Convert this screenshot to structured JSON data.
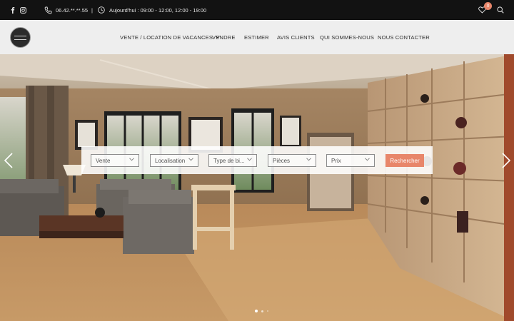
{
  "topbar": {
    "phone": "06.42.**.**.55",
    "separator": "|",
    "hours": "Aujourd'hui : 09:00 - 12:00, 12:00 - 19:00",
    "favorites_count": "0"
  },
  "nav": {
    "items": [
      {
        "label": "VENTE / LOCATION DE VACANCES"
      },
      {
        "label": "VENDRE"
      },
      {
        "label": "ESTIMER"
      },
      {
        "label": "AVIS CLIENTS"
      },
      {
        "label": "QUI SOMMES-NOUS"
      },
      {
        "label": "NOUS CONTACTER"
      }
    ]
  },
  "search": {
    "fields": [
      {
        "label": "Vente"
      },
      {
        "label": "Localisation"
      },
      {
        "label": "Type de bi..."
      },
      {
        "label": "Pièces"
      },
      {
        "label": "Prix"
      }
    ],
    "button_label": "Rechercher"
  },
  "icons": {
    "social": [
      "facebook-icon",
      "instagram-icon"
    ],
    "contact": [
      "phone-icon",
      "clock-icon"
    ],
    "actions": [
      "heart-icon",
      "search-icon"
    ],
    "slider": [
      "chevron-left-icon",
      "chevron-right-icon"
    ]
  },
  "slider": {
    "active_index": 0,
    "count": 3
  },
  "colors": {
    "accent": "#e8866a",
    "topbar_bg": "#121212",
    "nav_text": "#2e2e2e"
  }
}
